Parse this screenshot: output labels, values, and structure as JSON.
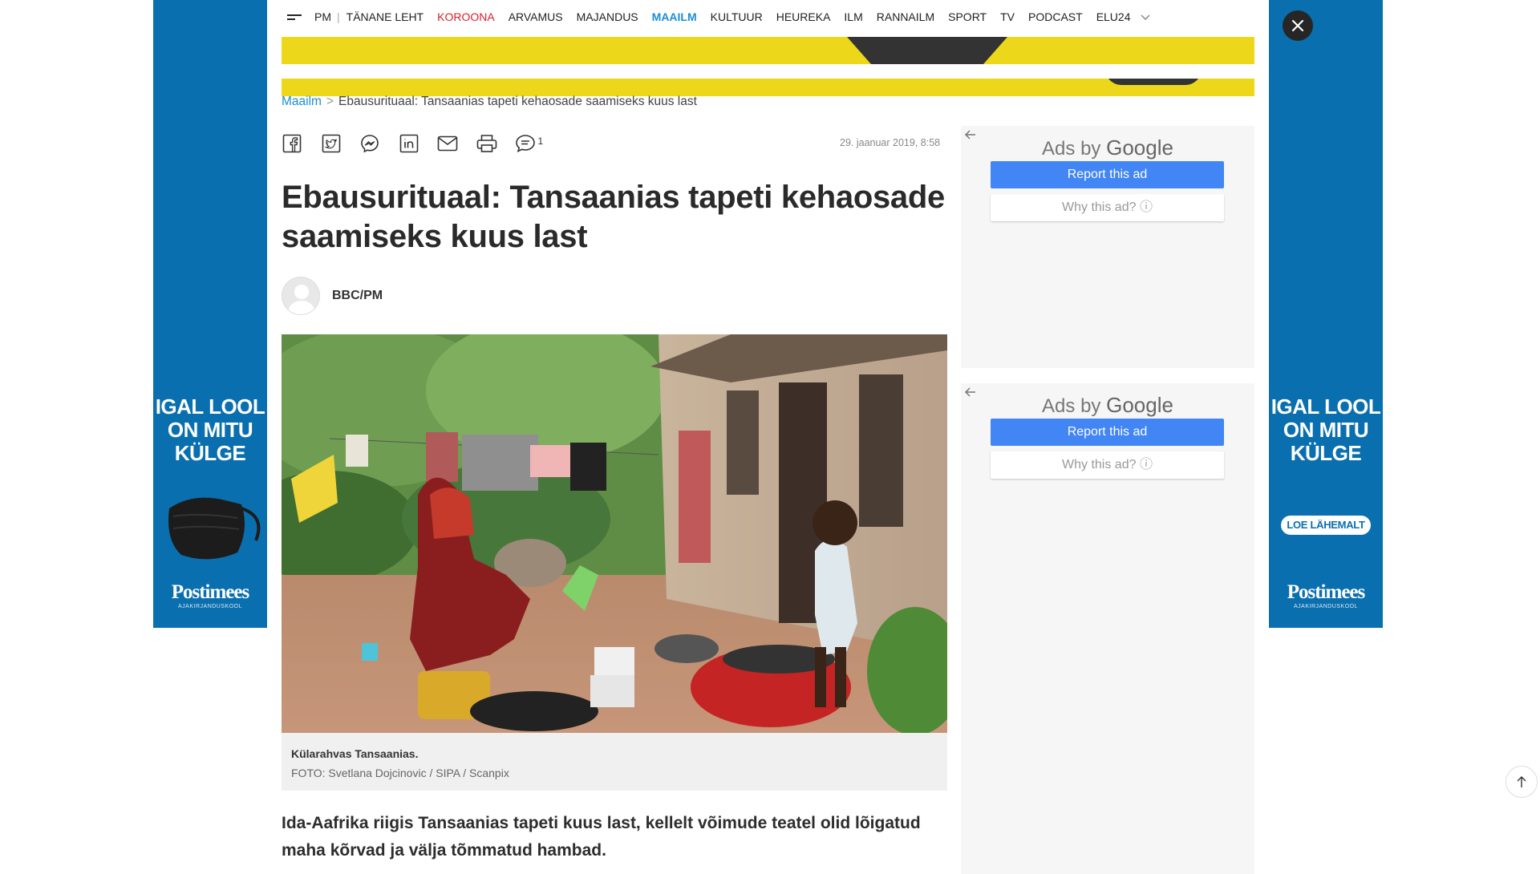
{
  "nav": {
    "items": [
      {
        "label": "PM",
        "style": "normal"
      },
      {
        "label": "TÄNANE LEHT",
        "style": "normal"
      },
      {
        "label": "KOROONA",
        "style": "red"
      },
      {
        "label": "ARVAMUS",
        "style": "normal"
      },
      {
        "label": "MAJANDUS",
        "style": "normal"
      },
      {
        "label": "MAAILM",
        "style": "blue"
      },
      {
        "label": "KULTUUR",
        "style": "normal"
      },
      {
        "label": "HEUREKA",
        "style": "normal"
      },
      {
        "label": "ILM",
        "style": "normal"
      },
      {
        "label": "RANNAILM",
        "style": "normal"
      },
      {
        "label": "SPORT",
        "style": "normal"
      },
      {
        "label": "TV",
        "style": "normal"
      },
      {
        "label": "PODCAST",
        "style": "normal"
      },
      {
        "label": "ELU24",
        "style": "normal"
      }
    ],
    "separator": "|"
  },
  "breadcrumb": {
    "section": "Maailm",
    "separator": ">",
    "current": "Ebausurituaal: Tansaanias tapeti kehaosade saamiseks kuus last"
  },
  "share": {
    "icons": [
      "facebook-icon",
      "twitter-icon",
      "messenger-icon",
      "linkedin-icon",
      "email-icon",
      "print-icon",
      "comments-icon"
    ],
    "comment_count": "1"
  },
  "article": {
    "date": "29. jaanuar 2019, 8:58",
    "title": "Ebausurituaal: Tansaanias tapeti kehaosade saamiseks kuus last",
    "author": "BBC/PM",
    "caption": "Külarahvas Tansaanias.",
    "credit": "FOTO: Svetlana Dojcinovic / SIPA / Scanpix",
    "lead": "Ida-Aafrika riigis Tansaanias tapeti kuus last, kellelt võimude teatel olid lõigatud maha kõrvad ja välja tõmmatud hambad."
  },
  "side_ads": {
    "left": {
      "headline": "IGAL LOOL ON MITU KÜLGE",
      "brand": "Postimees",
      "brand_sub": "AJAKIRJANDUSKOOL"
    },
    "right": {
      "headline": "IGAL LOOL ON MITU KÜLGE",
      "cta": "LOE LÄHEMALT",
      "brand": "Postimees",
      "brand_sub": "AJAKIRJANDUSKOOL"
    }
  },
  "google_ads": [
    {
      "ads_by": "Ads by",
      "google": "Google",
      "report": "Report this ad",
      "why": "Why this ad?"
    },
    {
      "ads_by": "Ads by",
      "google": "Google",
      "report": "Report this ad",
      "why": "Why this ad?"
    }
  ],
  "colors": {
    "accent_blue": "#1a8ed6",
    "accent_red": "#d8202b",
    "banner_yellow": "#ecd71a",
    "side_ad_blue": "#0a6fae",
    "google_blue": "#4285f4"
  }
}
